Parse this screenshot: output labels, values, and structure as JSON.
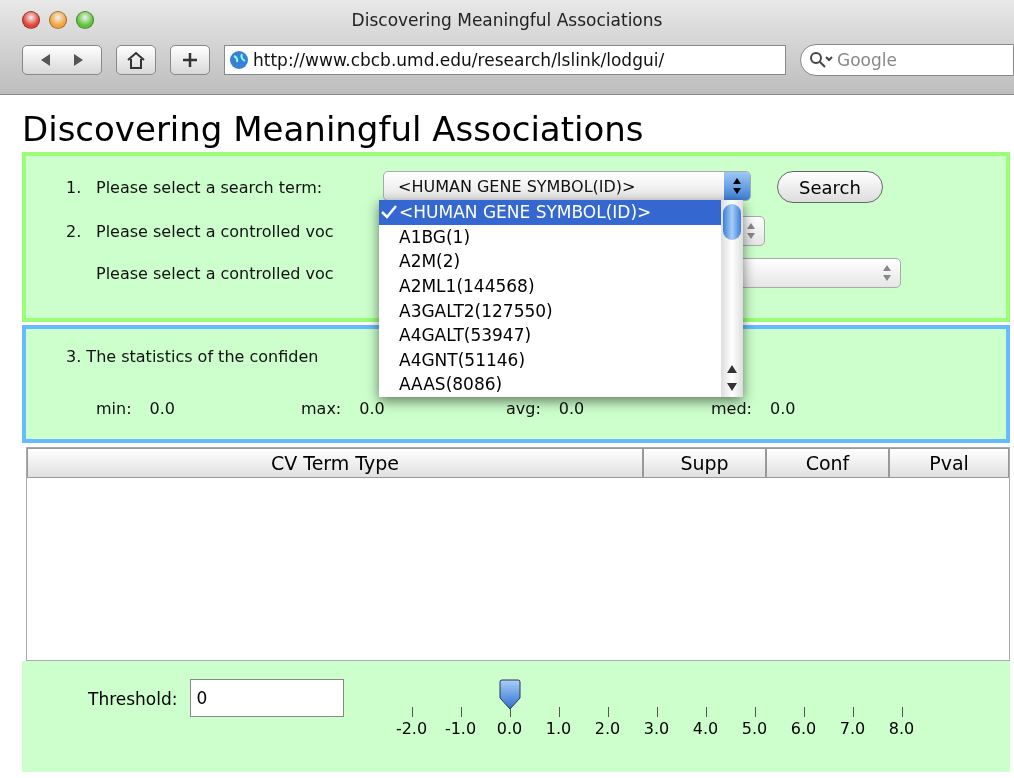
{
  "browser": {
    "title": "Discovering Meaningful Associations",
    "url": "http://www.cbcb.umd.edu/research/lslink/lodgui/",
    "search_placeholder": "Google"
  },
  "page_title": "Discovering Meaningful Associations",
  "steps": [
    {
      "number": "1.",
      "label": "Please select a search term:",
      "kind": "gene"
    },
    {
      "number": "2.",
      "label": "Please select a controlled voc",
      "kind": "small"
    },
    {
      "label": "Please select a controlled voc",
      "kind": "wide"
    }
  ],
  "search_select": {
    "value": "<HUMAN GENE SYMBOL(ID)>",
    "expanded": true
  },
  "search_button": "Search",
  "dropdown_options": [
    {
      "label": "<HUMAN GENE SYMBOL(ID)>",
      "selected": true
    },
    {
      "label": "A1BG(1)",
      "selected": false
    },
    {
      "label": "A2M(2)",
      "selected": false
    },
    {
      "label": "A2ML1(144568)",
      "selected": false
    },
    {
      "label": "A3GALT2(127550)",
      "selected": false
    },
    {
      "label": "A4GALT(53947)",
      "selected": false
    },
    {
      "label": "A4GNT(51146)",
      "selected": false
    },
    {
      "label": "AAAS(8086)",
      "selected": false
    }
  ],
  "statistics": {
    "label": "3. The statistics of the confiden",
    "stats": [
      {
        "label": "min:",
        "value": "0.0"
      },
      {
        "label": "max:",
        "value": "0.0"
      },
      {
        "label": "avg:",
        "value": "0.0"
      },
      {
        "label": "med:",
        "value": "0.0"
      }
    ]
  },
  "table": {
    "columns": [
      "CV Term Type",
      "Supp",
      "Conf",
      "Pval"
    ]
  },
  "threshold": {
    "label": "Threshold:",
    "value": "0",
    "ticks": [
      "-2.0",
      "-1.0",
      "0.0",
      "1.0",
      "2.0",
      "3.0",
      "4.0",
      "5.0",
      "6.0",
      "7.0",
      "8.0"
    ]
  }
}
